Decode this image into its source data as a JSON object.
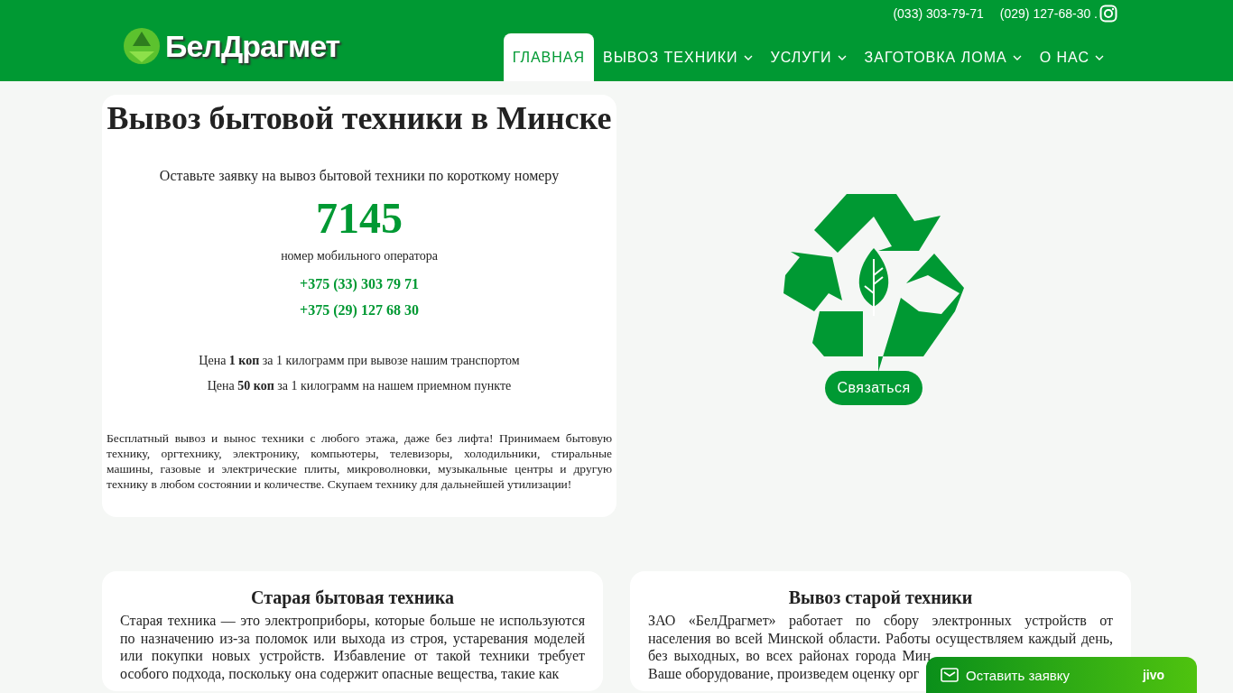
{
  "header": {
    "logo_text": "БелДрагмет",
    "phones": [
      "(033) 303-79-71",
      "(029) 127-68-30 ."
    ],
    "nav": [
      {
        "label": "ГЛАВНАЯ",
        "selected": true,
        "dropdown": false
      },
      {
        "label": "ВЫВОЗ ТЕХНИКИ",
        "selected": false,
        "dropdown": true
      },
      {
        "label": "УСЛУГИ",
        "selected": false,
        "dropdown": true
      },
      {
        "label": "ЗАГОТОВКА ЛОМА",
        "selected": false,
        "dropdown": true
      },
      {
        "label": "О НАС",
        "selected": false,
        "dropdown": true
      }
    ]
  },
  "hero": {
    "title": "Вывоз бытовой техники в Минске",
    "lead": "Оставьте заявку на вывоз бытовой техники по короткому номеру",
    "short_number": "7145",
    "short_number_note": "номер мобильного оператора",
    "phones": [
      "+375 (33) 303 79 71",
      "+375 (29) 127 68 30"
    ],
    "prices": [
      "Цена **1 коп** за 1 килограмм при вывозе нашим транспортом",
      "Цена **50 коп** за 1 килограмм на нашем приемном пункте"
    ],
    "description": "Бесплатный вывоз и вынос техники с любого этажа, даже без лифта! Принимаем бытовую технику, оргтехнику, электронику, компьютеры, телевизоры, холодильники, стиральные машины, газовые и электрические плиты, микроволновки, музыкальные центры и другую технику в любом состоянии и количестве. Скупаем технику для дальнейшей утилизации!",
    "contact_button": "Связаться"
  },
  "cards": [
    {
      "title": "Старая бытовая техника",
      "text": "Старая техника — это электроприборы, которые больше не используются по назначению из-за поломок или выхода из строя, устаревания моделей или покупки новых устройств. Избавление от такой техники требует особого подхода, поскольку она содержит опасные вещества, такие как"
    },
    {
      "title": "Вывоз старой техники",
      "text": "ЗАО «БелДрагмет» работает по сбору электронных устройств от населения во всей Минской области. Работы осуществляем каждый день,",
      "cut_lines": [
        "без выходных, во всех районах города Мин",
        "Ваше оборудование, произведем оценку орг"
      ]
    }
  ],
  "chat_widget": {
    "label": "Оставить заявку",
    "brand": "jivo"
  }
}
